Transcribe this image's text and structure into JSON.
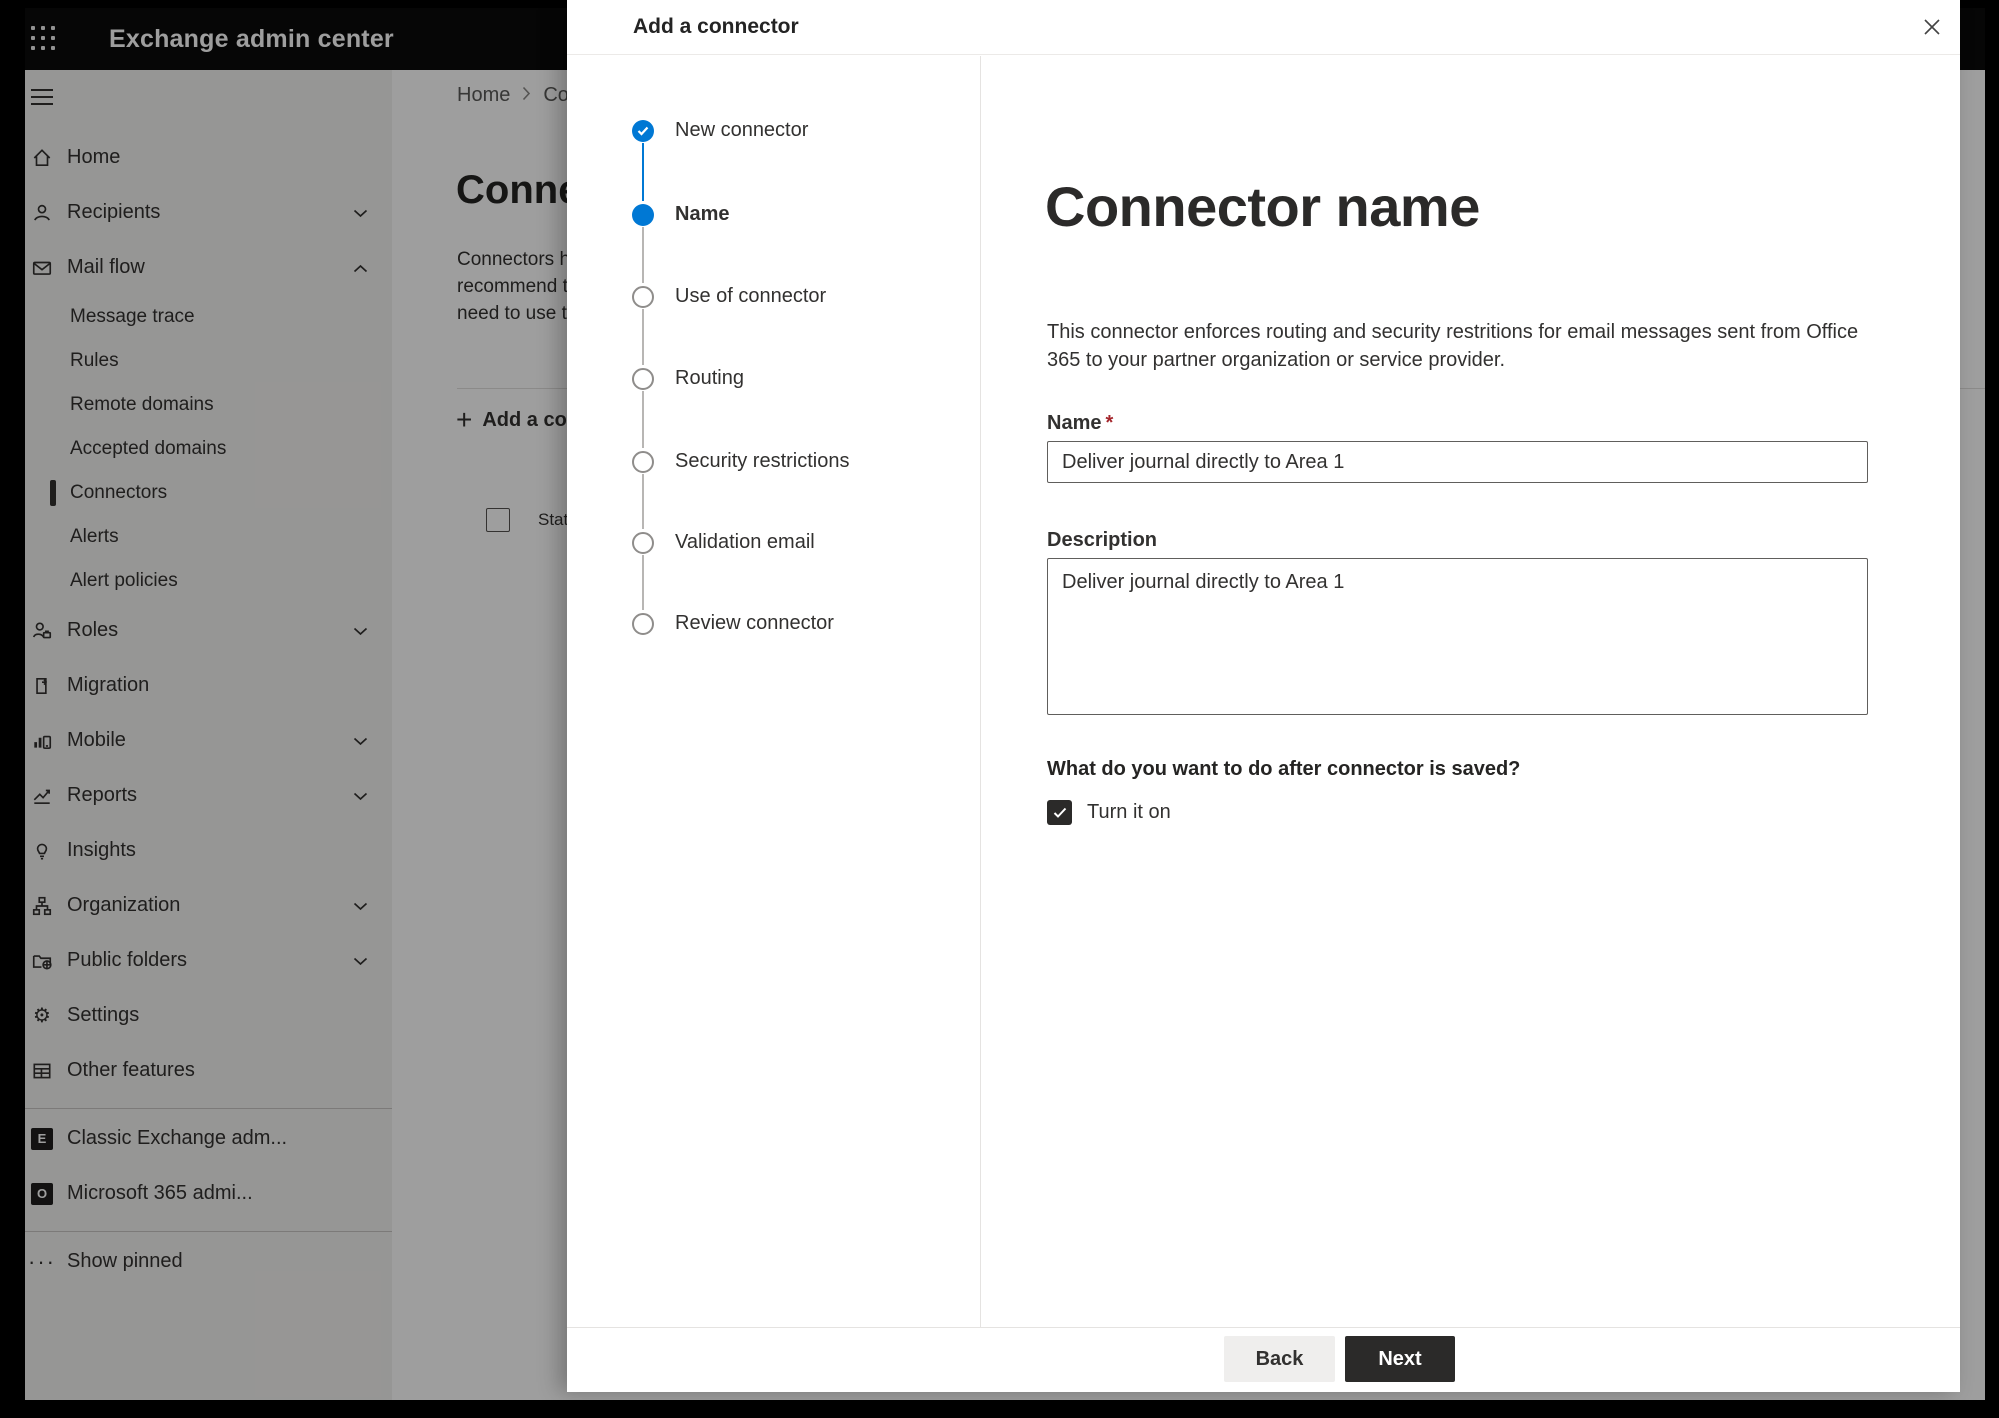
{
  "app": {
    "title": "Exchange admin center"
  },
  "sidebar": {
    "items": [
      {
        "label": "Home"
      },
      {
        "label": "Recipients"
      },
      {
        "label": "Mail flow"
      },
      {
        "label": "Message trace"
      },
      {
        "label": "Rules"
      },
      {
        "label": "Remote domains"
      },
      {
        "label": "Accepted domains"
      },
      {
        "label": "Connectors"
      },
      {
        "label": "Alerts"
      },
      {
        "label": "Alert policies"
      },
      {
        "label": "Roles"
      },
      {
        "label": "Migration"
      },
      {
        "label": "Mobile"
      },
      {
        "label": "Reports"
      },
      {
        "label": "Insights"
      },
      {
        "label": "Organization"
      },
      {
        "label": "Public folders"
      },
      {
        "label": "Settings"
      },
      {
        "label": "Other features"
      }
    ],
    "footer_items": [
      {
        "label": "Classic Exchange adm...",
        "logo_letter": "E"
      },
      {
        "label": "Microsoft 365 admi...",
        "logo_letter": "O"
      }
    ],
    "show_pinned": "Show pinned"
  },
  "page": {
    "breadcrumb": {
      "home": "Home",
      "current": "Conne"
    },
    "title": "Connec",
    "desc_lines": [
      "Connectors help",
      "recommend tha",
      "need to use ther"
    ],
    "add_button": "Add a conn",
    "table": {
      "status_header": "Status"
    }
  },
  "modal": {
    "title": "Add a connector",
    "steps": [
      {
        "label": "New connector",
        "state": "done"
      },
      {
        "label": "Name",
        "state": "active"
      },
      {
        "label": "Use of connector",
        "state": "todo"
      },
      {
        "label": "Routing",
        "state": "todo"
      },
      {
        "label": "Security restrictions",
        "state": "todo"
      },
      {
        "label": "Validation email",
        "state": "todo"
      },
      {
        "label": "Review connector",
        "state": "todo"
      }
    ],
    "content": {
      "heading": "Connector name",
      "description": "This connector enforces routing and security restritions for email messages sent from Office 365 to your partner organization or service provider.",
      "name_label": "Name",
      "required_mark": "*",
      "name_value": "Deliver journal directly to Area 1",
      "description_label": "Description",
      "description_value": "Deliver journal directly to Area 1",
      "question": "What do you want to do after connector is saved?",
      "turn_on_label": "Turn it on",
      "turn_on_checked": true
    },
    "footer": {
      "back": "Back",
      "next": "Next"
    }
  },
  "colors": {
    "accent_blue": "#0078d4",
    "header_bg": "#0a0a0a",
    "sidebar_bg": "#f3f2f1",
    "required_red": "#a4262c",
    "next_button_bg": "#2b2a29",
    "back_button_bg": "#efeeed"
  }
}
